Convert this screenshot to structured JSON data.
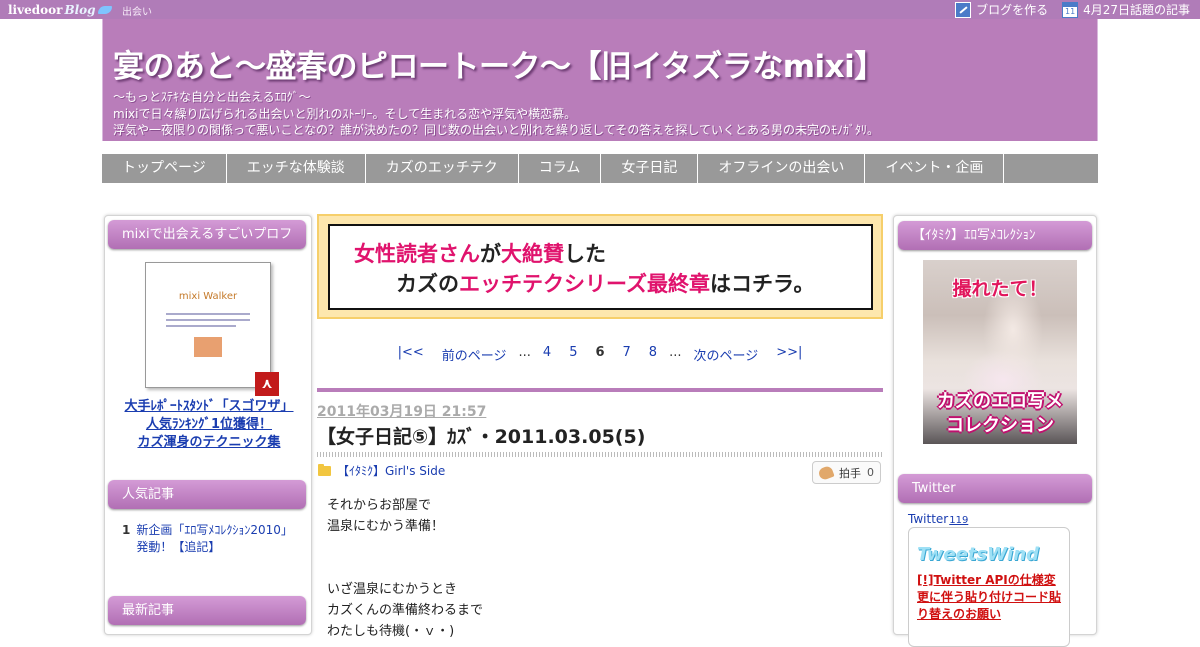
{
  "topbar": {
    "logo_main": "livedoor",
    "logo_sub": "Blog",
    "link_deai": "出会い",
    "create_blog": "ブログを作る",
    "topic_label": "4月27日話題の記事",
    "calendar_day": "11"
  },
  "header": {
    "title": "宴のあと～盛春のピロートーク～【旧イタズラなmixi】",
    "desc_lines": [
      "～もっとｽﾃｷな自分と出会えるｴﾛｸﾞ～",
      "mixiで日々繰り広げられる出会いと別れのｽﾄｰﾘｰ。そして生まれる恋や浮気や横恋慕。",
      "浮気や一夜限りの関係って悪いことなの？誰が決めたの？同じ数の出会いと別れを繰り返してその答えを探していくとある男の未完のﾓﾉｶﾞﾀﾘ。"
    ]
  },
  "nav": [
    "トップページ",
    "エッチな体験談",
    "カズのエッチテク",
    "コラム",
    "女子日記",
    "オフラインの出会い",
    "イベント・企画"
  ],
  "left_sidebar": {
    "prof_heading": "mixiで出会えるすごいプロフ",
    "pdf_title": "mixi Walker",
    "prof_link_lines": [
      "大手ﾚﾎﾟｰﾄｽﾀﾝﾄﾞ「スゴワザ」",
      "人気ﾗﾝｷﾝｸﾞ1位獲得！",
      "カズ渾身のテクニック集"
    ],
    "popular_heading": "人気記事",
    "popular_items": [
      {
        "num": "1",
        "text": "新企画「ｴﾛ写ﾒｺﾚｸｼｮﾝ2010」発動！【追記】"
      }
    ],
    "latest_heading": "最新記事"
  },
  "right_sidebar": {
    "photo_heading": "【ｲﾀﾐｸ】ｴﾛ写ﾒｺﾚｸｼｮﾝ",
    "photo_caption_top": "撮れたて！",
    "photo_caption_bottom_1": "カズのエロ写メ",
    "photo_caption_bottom_2": "コレクション",
    "twitter_heading": "Twitter",
    "twitter_img_alt": "Twitter",
    "twitter_count": "119",
    "tweetswind_logo": "TweetsWind",
    "tweetswind_notice": "[!]Twitter APIの仕様変更に伴う貼り付けコード貼り替えのお願い"
  },
  "banner": {
    "line1_a": "女性読者さん",
    "line1_b": "が",
    "line1_c": "大絶賛",
    "line1_d": "した",
    "line2_a": "カズの",
    "line2_b": "エッチテクシリーズ最終章",
    "line2_c": "はコチラ。"
  },
  "pager": {
    "first": "|<<",
    "prev": "前のページ",
    "dots1": "...",
    "p4": "4",
    "p5": "5",
    "current": "6",
    "p7": "7",
    "p8": "8",
    "dots2": "...",
    "next": "次のページ",
    "last": ">>|"
  },
  "post": {
    "date": "2011年03月19日 21:57",
    "title": "【女子日記⑤】ｶｽﾞ・2011.03.05(5)",
    "category": "【ｲﾀﾐｸ】Girl's Side",
    "clap_label": "拍手",
    "clap_count": "0",
    "body_lines": [
      "それからお部屋で",
      "温泉にむかう準備！",
      "",
      "",
      "いざ温泉にむかうとき",
      "カズくんの準備終わるまで",
      "わたしも待機(・ｖ・)"
    ]
  }
}
